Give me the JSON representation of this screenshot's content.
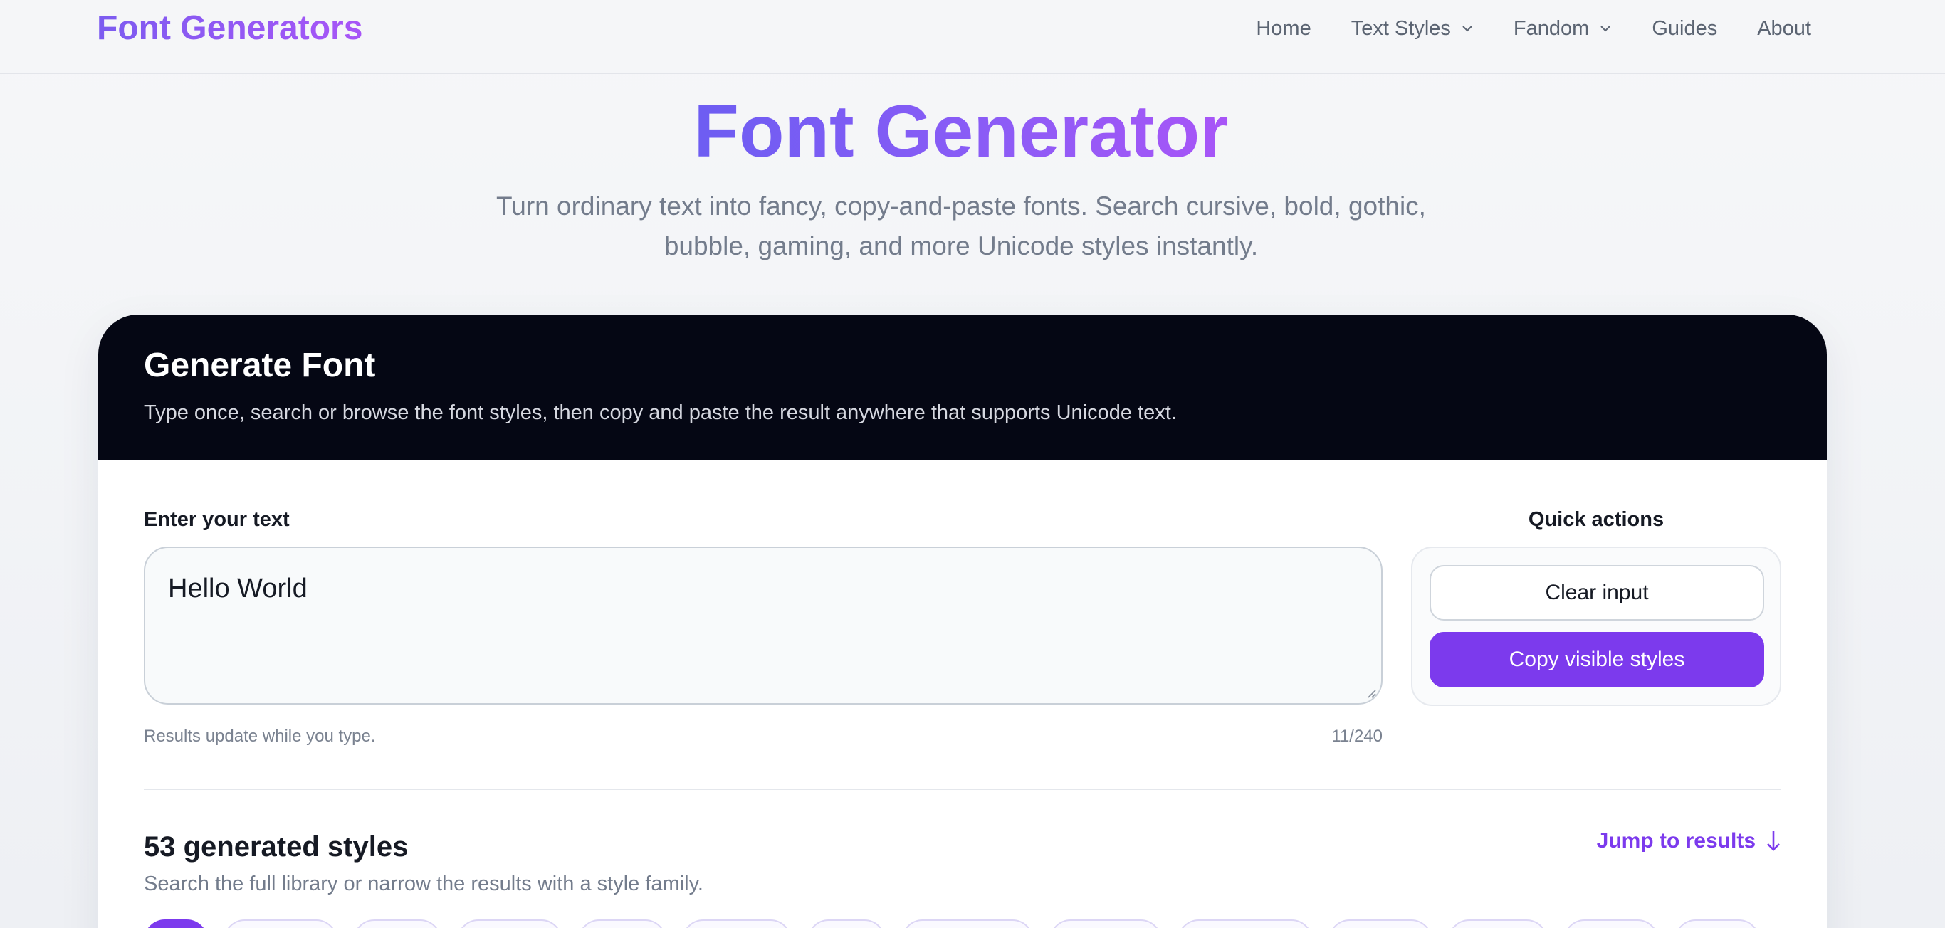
{
  "header": {
    "brand": "Font Generators",
    "nav": [
      {
        "label": "Home"
      },
      {
        "label": "Text Styles"
      },
      {
        "label": "Fandom"
      },
      {
        "label": "Guides"
      },
      {
        "label": "About"
      }
    ]
  },
  "hero": {
    "title": "Font Generator",
    "subtitle": "Turn ordinary text into fancy, copy-and-paste fonts. Search cursive, bold, gothic, bubble, gaming, and more Unicode styles instantly."
  },
  "card": {
    "title": "Generate Font",
    "description": "Type once, search or browse the font styles, then copy and paste the result anywhere that supports Unicode text.",
    "input_label": "Enter your text",
    "input_value": "Hello World",
    "helper": "Results update while you type.",
    "counter": "11/240",
    "quick_actions_label": "Quick actions",
    "clear_label": "Clear input",
    "copy_label": "Copy visible styles",
    "styles_count": "53 generated styles",
    "jump_label": "Jump to results",
    "styles_sub": "Search the full library or narrow the results with a style family."
  },
  "colors": {
    "accent": "#7c3aed",
    "brand_gradient_start": "#6d5df2",
    "brand_gradient_end": "#a855f7",
    "card_header_bg": "#050714"
  },
  "icons": {
    "dropdown": "chevron-down-icon",
    "jump": "arrow-down-icon",
    "resize": "resize-grip-icon"
  }
}
